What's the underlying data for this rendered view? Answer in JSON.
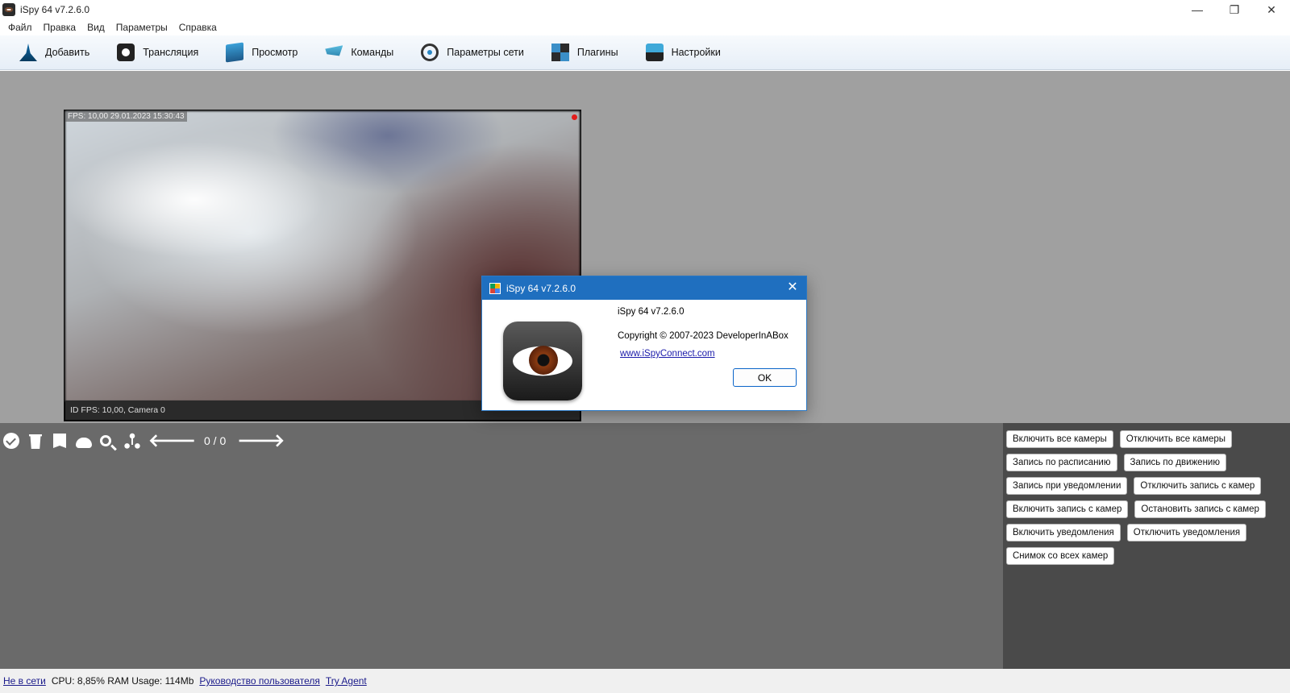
{
  "window": {
    "title": "iSpy 64 v7.2.6.0",
    "controls": {
      "minimize": "—",
      "restore": "❐",
      "close": "✕"
    }
  },
  "menu": [
    "Файл",
    "Правка",
    "Вид",
    "Параметры",
    "Справка"
  ],
  "toolbar": [
    {
      "label": "Добавить",
      "icon": "add-icon"
    },
    {
      "label": "Трансляция",
      "icon": "broadcast-icon"
    },
    {
      "label": "Просмотр",
      "icon": "view-icon"
    },
    {
      "label": "Команды",
      "icon": "commands-icon"
    },
    {
      "label": "Параметры сети",
      "icon": "network-icon"
    },
    {
      "label": "Плагины",
      "icon": "plugins-icon"
    },
    {
      "label": "Настройки",
      "icon": "settings-icon"
    }
  ],
  "camera": {
    "overlay_top": "FPS: 10,00 29.01.2023 15:30:43",
    "overlay_bottom": "ID  FPS: 10,00, Camera 0",
    "recording_color": "#e31c1c"
  },
  "thumbbar": {
    "back_arrow": "🡐",
    "forward_arrow": "🡒",
    "counter": "0 / 0"
  },
  "panel_buttons": [
    [
      "Включить все камеры",
      "Отключить все камеры"
    ],
    [
      "Запись по расписанию",
      "Запись по движению"
    ],
    [
      "Запись при уведомлении",
      "Отключить запись с камер"
    ],
    [
      "Включить запись с камер",
      "Остановить запись с камер"
    ],
    [
      "Включить  уведомления",
      "Отключить уведомления"
    ],
    [
      "Снимок со всех камер"
    ]
  ],
  "statusbar": {
    "offline": "Не в сети",
    "usage": "CPU: 8,85% RAM Usage: 114Mb",
    "manual": "Руководство пользователя",
    "agent": "Try Agent"
  },
  "dialog": {
    "title": "iSpy 64 v7.2.6.0",
    "close": "✕",
    "version": "iSpy 64 v7.2.6.0",
    "copyright": "Copyright © 2007-2023 DeveloperInABox",
    "link": "www.iSpyConnect.com",
    "ok": "OK",
    "title_color": "#1f6fbf"
  }
}
